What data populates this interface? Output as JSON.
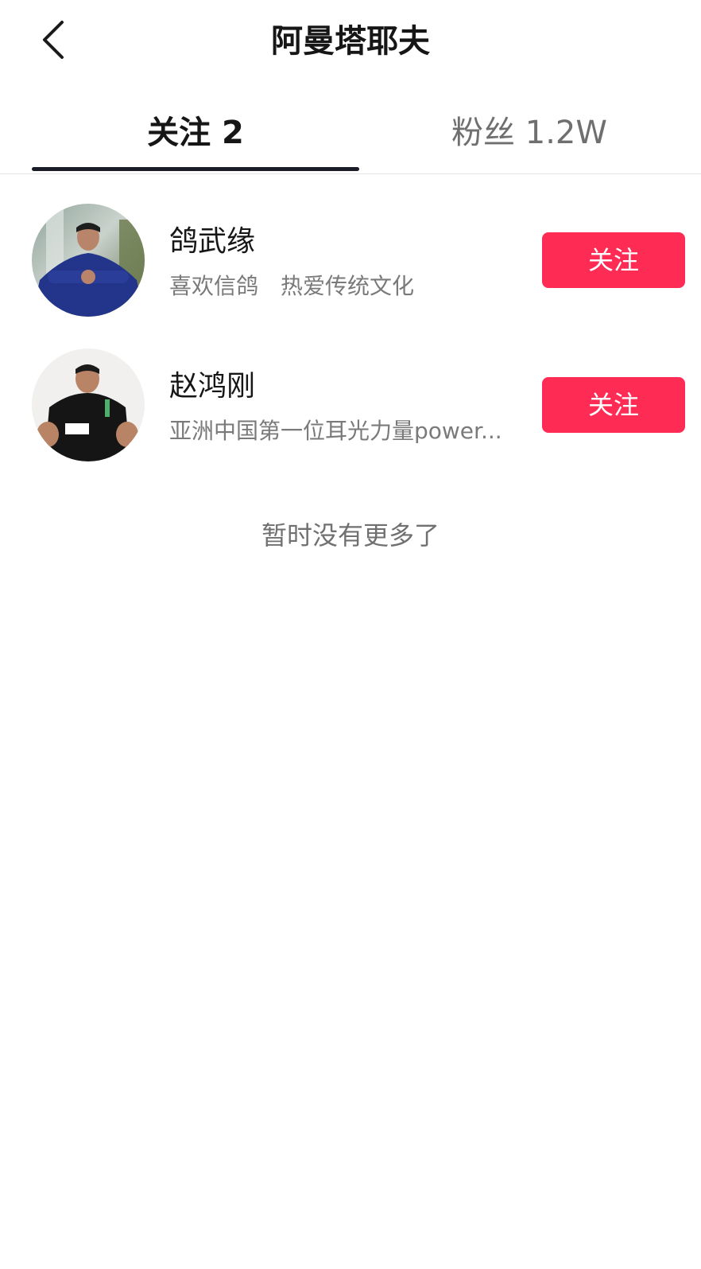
{
  "header": {
    "title": "阿曼塔耶夫",
    "back_icon": "chevron-left-icon"
  },
  "tabs": [
    {
      "label": "关注 2",
      "active": true
    },
    {
      "label": "粉丝 1.2W",
      "active": false
    }
  ],
  "following": [
    {
      "name": "鸽武缘",
      "bio": "喜欢信鸽　热爱传统文化",
      "button_label": "关注"
    },
    {
      "name": "赵鸿刚",
      "bio": "亚洲中国第一位耳光力量power...",
      "button_label": "关注"
    }
  ],
  "footer_note": "暂时没有更多了",
  "colors": {
    "accent": "#fe2c55",
    "tab_indicator": "#1b1d26",
    "secondary_text": "#7a7a7a"
  }
}
